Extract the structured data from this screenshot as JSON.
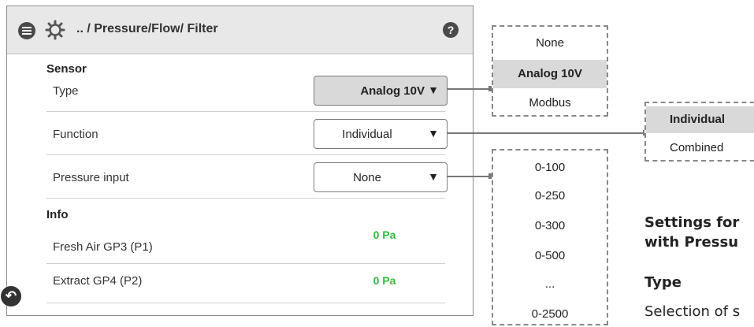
{
  "header": {
    "breadcrumb": ".. / Pressure/Flow/ Filter",
    "help": "?"
  },
  "sensor": {
    "title": "Sensor",
    "rows": [
      {
        "label": "Type",
        "value": "Analog 10V"
      },
      {
        "label": "Function",
        "value": "Individual"
      },
      {
        "label": "Pressure input",
        "value": "None"
      }
    ]
  },
  "info": {
    "title": "Info",
    "rows": [
      {
        "label": "Fresh Air GP3 (P1)",
        "value": "0 Pa"
      },
      {
        "label": "Extract GP4 (P2)",
        "value": "0 Pa"
      }
    ]
  },
  "type_options": [
    "None",
    "Analog 10V",
    "Modbus"
  ],
  "function_options": [
    "Individual",
    "Combined"
  ],
  "pressure_options": [
    "0-100",
    "0-250",
    "0-300",
    "0-500",
    "...",
    "0-2500"
  ],
  "doc": {
    "heading_line1": "Settings for",
    "heading_line2": "with Pressu",
    "type_heading": "Type",
    "type_text": "Selection of s"
  },
  "colors": {
    "accent_green": "#2fbf3a",
    "selected_bg": "#d9d9d9",
    "header_bg": "#e8e8e8"
  }
}
